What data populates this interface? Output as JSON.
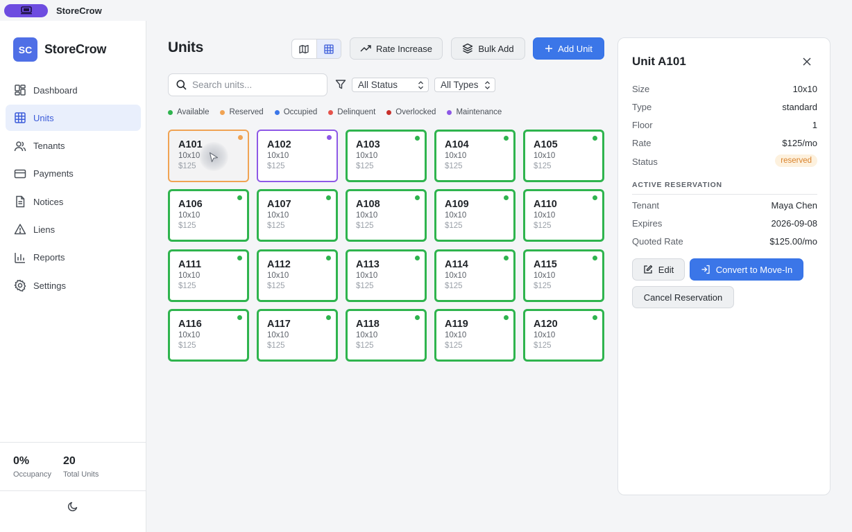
{
  "titlebar": {
    "app_name": "StoreCrow"
  },
  "sidebar": {
    "brand": {
      "logo_text": "SC",
      "name": "StoreCrow"
    },
    "items": [
      {
        "label": "Dashboard",
        "icon": "dashboard-icon",
        "active": false
      },
      {
        "label": "Units",
        "icon": "grid-icon",
        "active": true
      },
      {
        "label": "Tenants",
        "icon": "users-icon",
        "active": false
      },
      {
        "label": "Payments",
        "icon": "credit-card-icon",
        "active": false
      },
      {
        "label": "Notices",
        "icon": "document-icon",
        "active": false
      },
      {
        "label": "Liens",
        "icon": "warning-icon",
        "active": false
      },
      {
        "label": "Reports",
        "icon": "bar-chart-icon",
        "active": false
      },
      {
        "label": "Settings",
        "icon": "gear-icon",
        "active": false
      }
    ],
    "stats": {
      "occupancy_value": "0%",
      "occupancy_label": "Occupancy",
      "total_value": "20",
      "total_label": "Total Units"
    }
  },
  "header": {
    "title": "Units",
    "view_mode": "grid",
    "rate_increase_label": "Rate Increase",
    "bulk_add_label": "Bulk Add",
    "add_unit_label": "Add Unit"
  },
  "filters": {
    "search_placeholder": "Search units...",
    "status_value": "All Status",
    "type_value": "All Types"
  },
  "legend": [
    {
      "label": "Available",
      "color": "#2fb44e"
    },
    {
      "label": "Reserved",
      "color": "#f0a353"
    },
    {
      "label": "Occupied",
      "color": "#3b76e8"
    },
    {
      "label": "Delinquent",
      "color": "#e5534b"
    },
    {
      "label": "Overlocked",
      "color": "#c8302b"
    },
    {
      "label": "Maintenance",
      "color": "#8d58e6"
    }
  ],
  "colors": {
    "available": "#2fb44e",
    "reserved": "#f0a353",
    "maintenance": "#8d58e6",
    "accent": "#3b76e8"
  },
  "units": [
    {
      "id": "A101",
      "size": "10x10",
      "rate": "$125",
      "status": "reserved"
    },
    {
      "id": "A102",
      "size": "10x10",
      "rate": "$125",
      "status": "maintenance"
    },
    {
      "id": "A103",
      "size": "10x10",
      "rate": "$125",
      "status": "available"
    },
    {
      "id": "A104",
      "size": "10x10",
      "rate": "$125",
      "status": "available"
    },
    {
      "id": "A105",
      "size": "10x10",
      "rate": "$125",
      "status": "available"
    },
    {
      "id": "A106",
      "size": "10x10",
      "rate": "$125",
      "status": "available"
    },
    {
      "id": "A107",
      "size": "10x10",
      "rate": "$125",
      "status": "available"
    },
    {
      "id": "A108",
      "size": "10x10",
      "rate": "$125",
      "status": "available"
    },
    {
      "id": "A109",
      "size": "10x10",
      "rate": "$125",
      "status": "available"
    },
    {
      "id": "A110",
      "size": "10x10",
      "rate": "$125",
      "status": "available"
    },
    {
      "id": "A111",
      "size": "10x10",
      "rate": "$125",
      "status": "available"
    },
    {
      "id": "A112",
      "size": "10x10",
      "rate": "$125",
      "status": "available"
    },
    {
      "id": "A113",
      "size": "10x10",
      "rate": "$125",
      "status": "available"
    },
    {
      "id": "A114",
      "size": "10x10",
      "rate": "$125",
      "status": "available"
    },
    {
      "id": "A115",
      "size": "10x10",
      "rate": "$125",
      "status": "available"
    },
    {
      "id": "A116",
      "size": "10x10",
      "rate": "$125",
      "status": "available"
    },
    {
      "id": "A117",
      "size": "10x10",
      "rate": "$125",
      "status": "available"
    },
    {
      "id": "A118",
      "size": "10x10",
      "rate": "$125",
      "status": "available"
    },
    {
      "id": "A119",
      "size": "10x10",
      "rate": "$125",
      "status": "available"
    },
    {
      "id": "A120",
      "size": "10x10",
      "rate": "$125",
      "status": "available"
    }
  ],
  "detail": {
    "title": "Unit A101",
    "size_label": "Size",
    "size_value": "10x10",
    "type_label": "Type",
    "type_value": "standard",
    "floor_label": "Floor",
    "floor_value": "1",
    "rate_label": "Rate",
    "rate_value": "$125/mo",
    "status_label": "Status",
    "status_value": "reserved",
    "reservation_heading": "ACTIVE RESERVATION",
    "tenant_label": "Tenant",
    "tenant_value": "Maya Chen",
    "expires_label": "Expires",
    "expires_value": "2026-09-08",
    "quoted_label": "Quoted Rate",
    "quoted_value": "$125.00/mo",
    "edit_label": "Edit",
    "convert_label": "Convert to Move-In",
    "cancel_label": "Cancel Reservation"
  }
}
